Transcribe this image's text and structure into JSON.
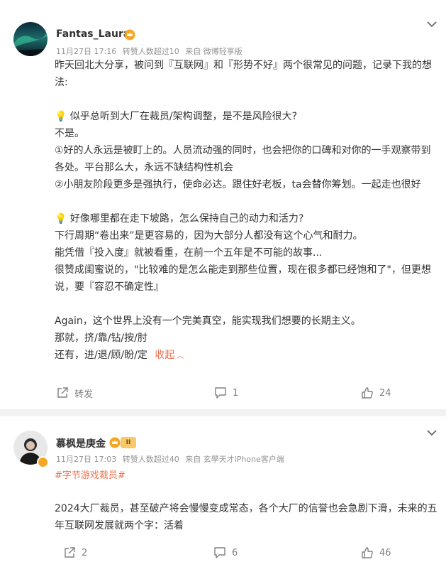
{
  "posts": [
    {
      "username": "Fantas_Laura",
      "date": "11月27日 17:16",
      "repost_info": "转赞人数超过10",
      "source": "来自 微博轻享版",
      "lines": [
        "昨天回北大分享，被问到『互联网』和『形势不好』两个很常见的问题，记录下我的想",
        "法:",
        "",
        "💡 似乎总听到大厂在裁员/架构调整，是不是风险很大?",
        "不是。",
        "①好的人永远是被盯上的。人员流动强的同时，也会把你的口碑和对你的一手观察带到",
        "各处。平台那么大，永远不缺结构性机会",
        "②小朋友阶段更多是强执行，使命必达。跟住好老板，ta会替你筹划。一起走也很好",
        "",
        "💡 好像哪里都在走下坡路，怎么保持自己的动力和活力?",
        "下行周期“卷出来”是更容易的，因为大部分人都没有这个心气和耐力。",
        "能凭借『投入度』就被看重，在前一个五年是不可能的故事...",
        "很赞成闺蜜说的，\"比较难的是怎么能走到那些位置，现在很多都已经饱和了\"，但更想",
        "说，要『容忍不确定性』",
        "",
        "Again，这个世界上没有一个完美真空，能实现我们想要的长期主义。",
        "那就，挤/靠/钻/按/肘"
      ],
      "last_line": "还有，进/退/顾/盼/定",
      "collapse_label": "收起",
      "repost_label": "转发",
      "comment_count": "1",
      "like_count": "24"
    },
    {
      "username": "慕枫是庚金",
      "level_badge": "II",
      "date": "11月27日 17:03",
      "repost_info": "转赞人数超过40",
      "source": "来自 玄學天才iPhone客户端",
      "hashtag": "#字节游戏裁员#",
      "lines": [
        "2024大厂裁员，甚至破产将会慢慢变成常态，各个大厂的信誉也会急剧下滑，未来的五",
        "年互联网发展就两个字：活着"
      ],
      "repost_count": "2",
      "comment_count": "6",
      "like_count": "46"
    }
  ],
  "colors": {
    "accent": "#eb7350",
    "meta": "#939393",
    "text": "#333333",
    "separator": "#f2f2f2"
  },
  "icons": [
    "chevron-down-icon",
    "vip-crown-icon",
    "level-badge-icon",
    "repost-icon",
    "comment-icon",
    "like-icon"
  ]
}
